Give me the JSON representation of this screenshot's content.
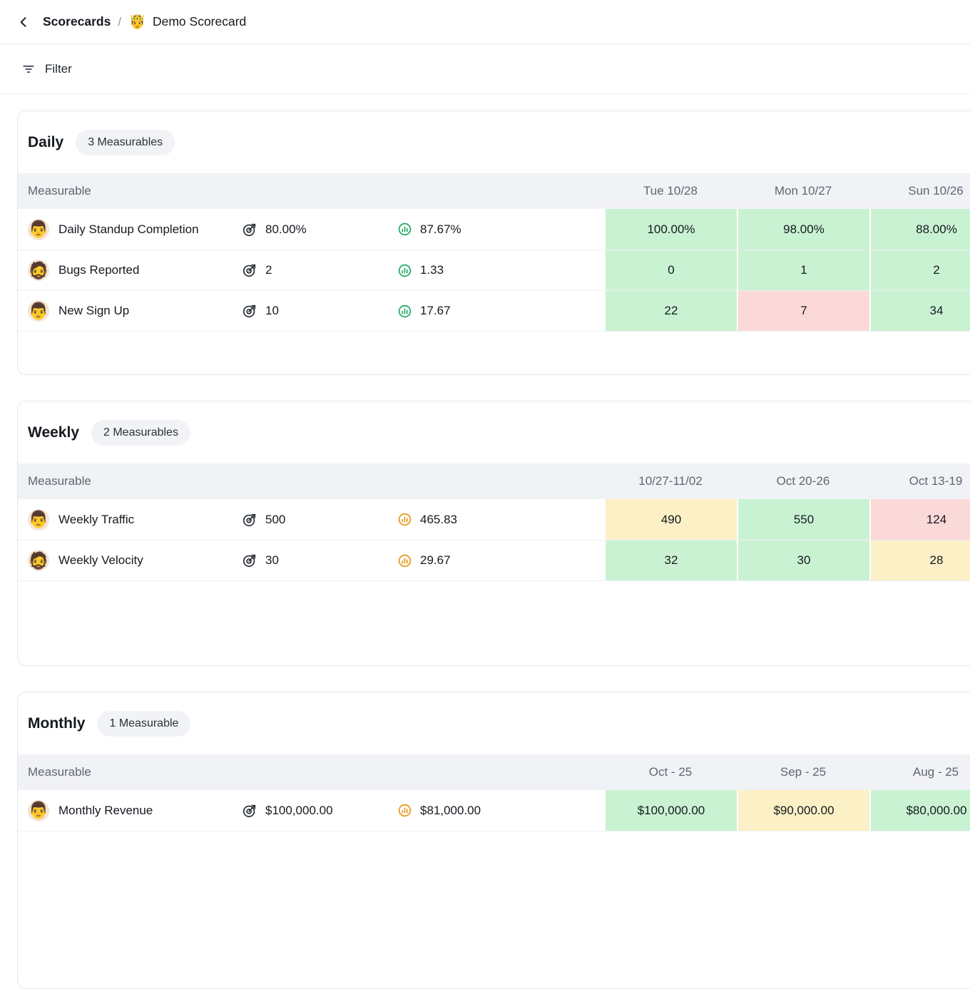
{
  "topbar": {
    "breadcrumb_root": "Scorecards",
    "separator": "/",
    "title_emoji": "🤴",
    "title": "Demo Scorecard"
  },
  "filter": {
    "label": "Filter"
  },
  "icons": {
    "back": "chevron-left-icon",
    "filter": "filter-lines-icon",
    "goal": "target-arrow-icon",
    "average": "bar-chart-circle-icon"
  },
  "colors": {
    "cell_green": "#c9f2d3",
    "cell_red": "#fbd9d9",
    "cell_yellow": "#fcf0c6",
    "green_icon": "#18a95f",
    "orange_icon": "#e9930f",
    "header_bg": "#f1f2f5",
    "border": "#e4e7ec"
  },
  "sections": [
    {
      "title": "Daily",
      "badge": "3 Measurables",
      "measurable_label": "Measurable",
      "columns": [
        "Tue 10/28",
        "Mon 10/27",
        "Sun 10/26"
      ],
      "rows": [
        {
          "avatar": "👨",
          "name": "Daily Standup Completion",
          "goal": "80.00%",
          "average": "87.67%",
          "average_color": "green",
          "cells": [
            {
              "value": "100.00%",
              "status": "green"
            },
            {
              "value": "98.00%",
              "status": "green"
            },
            {
              "value": "88.00%",
              "status": "green"
            }
          ]
        },
        {
          "avatar": "🧔",
          "name": "Bugs Reported",
          "goal": "2",
          "average": "1.33",
          "average_color": "green",
          "cells": [
            {
              "value": "0",
              "status": "green"
            },
            {
              "value": "1",
              "status": "green"
            },
            {
              "value": "2",
              "status": "green"
            }
          ]
        },
        {
          "avatar": "👨",
          "name": "New Sign Up",
          "goal": "10",
          "average": "17.67",
          "average_color": "green",
          "cells": [
            {
              "value": "22",
              "status": "green"
            },
            {
              "value": "7",
              "status": "red"
            },
            {
              "value": "34",
              "status": "green"
            }
          ]
        }
      ]
    },
    {
      "title": "Weekly",
      "badge": "2 Measurables",
      "measurable_label": "Measurable",
      "columns": [
        "10/27-11/02",
        "Oct 20-26",
        "Oct 13-19"
      ],
      "rows": [
        {
          "avatar": "👨",
          "name": "Weekly Traffic",
          "goal": "500",
          "average": "465.83",
          "average_color": "orange",
          "cells": [
            {
              "value": "490",
              "status": "yellow"
            },
            {
              "value": "550",
              "status": "green"
            },
            {
              "value": "124",
              "status": "red"
            }
          ]
        },
        {
          "avatar": "🧔",
          "name": "Weekly Velocity",
          "goal": "30",
          "average": "29.67",
          "average_color": "orange",
          "cells": [
            {
              "value": "32",
              "status": "green"
            },
            {
              "value": "30",
              "status": "green"
            },
            {
              "value": "28",
              "status": "yellow"
            }
          ]
        }
      ]
    },
    {
      "title": "Monthly",
      "badge": "1 Measurable",
      "measurable_label": "Measurable",
      "columns": [
        "Oct - 25",
        "Sep - 25",
        "Aug - 25"
      ],
      "rows": [
        {
          "avatar": "👨",
          "name": "Monthly Revenue",
          "goal": "$100,000.00",
          "average": "$81,000.00",
          "average_color": "orange",
          "cells": [
            {
              "value": "$100,000.00",
              "status": "green"
            },
            {
              "value": "$90,000.00",
              "status": "yellow"
            },
            {
              "value": "$80,000.00",
              "status": "green"
            }
          ]
        }
      ]
    }
  ]
}
